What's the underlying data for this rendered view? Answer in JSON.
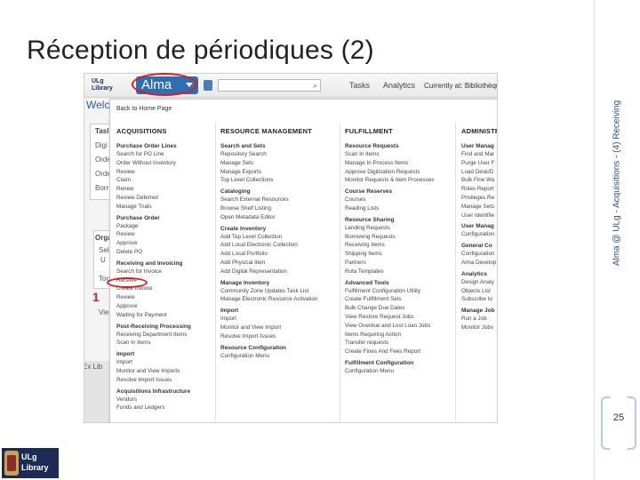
{
  "slide": {
    "title": "Réception de périodiques (2)",
    "side_text": "Alma @ ULg - Acquisitions - (4) Receiving",
    "page_number": "25",
    "callout_number": "1",
    "footer_logo_line1": "ULg",
    "footer_logo_line2": "Library"
  },
  "alma": {
    "logo_line1": "ULg",
    "logo_line2": "Library",
    "menu_button_label": "Alma",
    "top_tasks": "Tasks",
    "top_analytics": "Analytics",
    "current_at": "Currently at: Bibliothèque",
    "background": {
      "welcome": "Welc",
      "task_label": "Tasl",
      "task_items": [
        "Digi",
        "Orde",
        "Orde",
        "Borr"
      ],
      "org_label": "Orga",
      "sel": "Sel",
      "sel_value": "U",
      "too": "Too",
      "view": "Vie",
      "ex_lib": "Ex Lib"
    },
    "menu": {
      "back_home": "Back to Home Page",
      "columns": [
        {
          "header": "ACQUISITIONS",
          "sections": [
            {
              "title": "Purchase Order Lines",
              "items": [
                "Search for PO Line",
                "Order Without Inventory",
                "Review",
                "Claim",
                "Renew",
                "Review Deferred",
                "Manage Trials"
              ]
            },
            {
              "title": "Purchase Order",
              "items": [
                "Package",
                "Review",
                "Approve",
                "Delete PO"
              ]
            },
            {
              "title": "Receiving and Invoicing",
              "items": [
                "Search for Invoice",
                "Receive",
                "Create Invoice",
                "Review",
                "Approve",
                "Waiting for Payment"
              ]
            },
            {
              "title": "Post-Receiving Processing",
              "items": [
                "Receiving Department Items",
                "Scan In Items"
              ]
            },
            {
              "title": "Import",
              "items": [
                "Import",
                "Monitor and View Imports",
                "Resolve Import Issues"
              ]
            },
            {
              "title": "Acquisitions Infrastructure",
              "items": [
                "Vendors",
                "Funds and Ledgers"
              ]
            }
          ]
        },
        {
          "header": "RESOURCE MANAGEMENT",
          "sections": [
            {
              "title": "Search and Sets",
              "items": [
                "Repository Search",
                "Manage Sets",
                "Manage Exports",
                "Top Level Collections"
              ]
            },
            {
              "title": "Cataloging",
              "items": [
                "Search External Resources",
                "Browse Shelf Listing",
                "Open Metadata Editor"
              ]
            },
            {
              "title": "Create Inventory",
              "items": [
                "Add Top Level Collection",
                "Add Local Electronic Collection",
                "Add Local Portfolio",
                "Add Physical Item",
                "Add Digital Representation"
              ]
            },
            {
              "title": "Manage Inventory",
              "items": [
                "Community Zone Updates Task List",
                "Manage Electronic Resource Activation"
              ]
            },
            {
              "title": "Import",
              "items": [
                "Import",
                "Monitor and View Import",
                "Resolve Import Issues"
              ]
            },
            {
              "title": "Resource Configuration",
              "items": [
                "Configuration Menu"
              ]
            }
          ]
        },
        {
          "header": "FULFILLMENT",
          "sections": [
            {
              "title": "Resource Requests",
              "items": [
                "Scan In Items",
                "Manage In Process Items",
                "Approve Digitization Requests",
                "Monitor Requests & Item Processes"
              ]
            },
            {
              "title": "Course Reserves",
              "items": [
                "Courses",
                "Reading Lists"
              ]
            },
            {
              "title": "Resource Sharing",
              "items": [
                "Lending Requests",
                "Borrowing Requests",
                "Receiving Items",
                "Shipping Items",
                "Partners",
                "Rota Templates"
              ]
            },
            {
              "title": "Advanced Tools",
              "items": [
                "Fulfillment Configuration Utility",
                "Create Fulfillment Sets",
                "Bulk Change Due Dates",
                "View Restore Request Jobs",
                "View Overdue and Lost Loan Jobs",
                "Items Requiring Action",
                "Transfer requests",
                "Create Fines And Fees Report"
              ]
            },
            {
              "title": "Fulfillment Configuration",
              "items": [
                "Configuration Menu"
              ]
            }
          ]
        },
        {
          "header": "ADMINISTR",
          "sections": [
            {
              "title": "User Manag",
              "items": [
                "Find and Mar",
                "Purge User F",
                "Load Desk/D",
                "Bulk Fine Wa",
                "Roles Report",
                "Privileges Re",
                "Manage Sets",
                "User Identifie"
              ]
            },
            {
              "title": "User Manag",
              "items": [
                "Configuration"
              ]
            },
            {
              "title": "General Co",
              "items": [
                "Configuration",
                "Alma Develop"
              ]
            },
            {
              "title": "Analytics",
              "items": [
                "Design Analy",
                "Objects List",
                "Subscribe to"
              ]
            },
            {
              "title": "Manage Job",
              "items": [
                "Run a Job",
                "Monitor Jobs"
              ]
            }
          ]
        }
      ]
    }
  },
  "colors": {
    "alma_blue": "#2f6db5",
    "highlight_red": "#d32020",
    "side_text": "#2f4f80"
  }
}
